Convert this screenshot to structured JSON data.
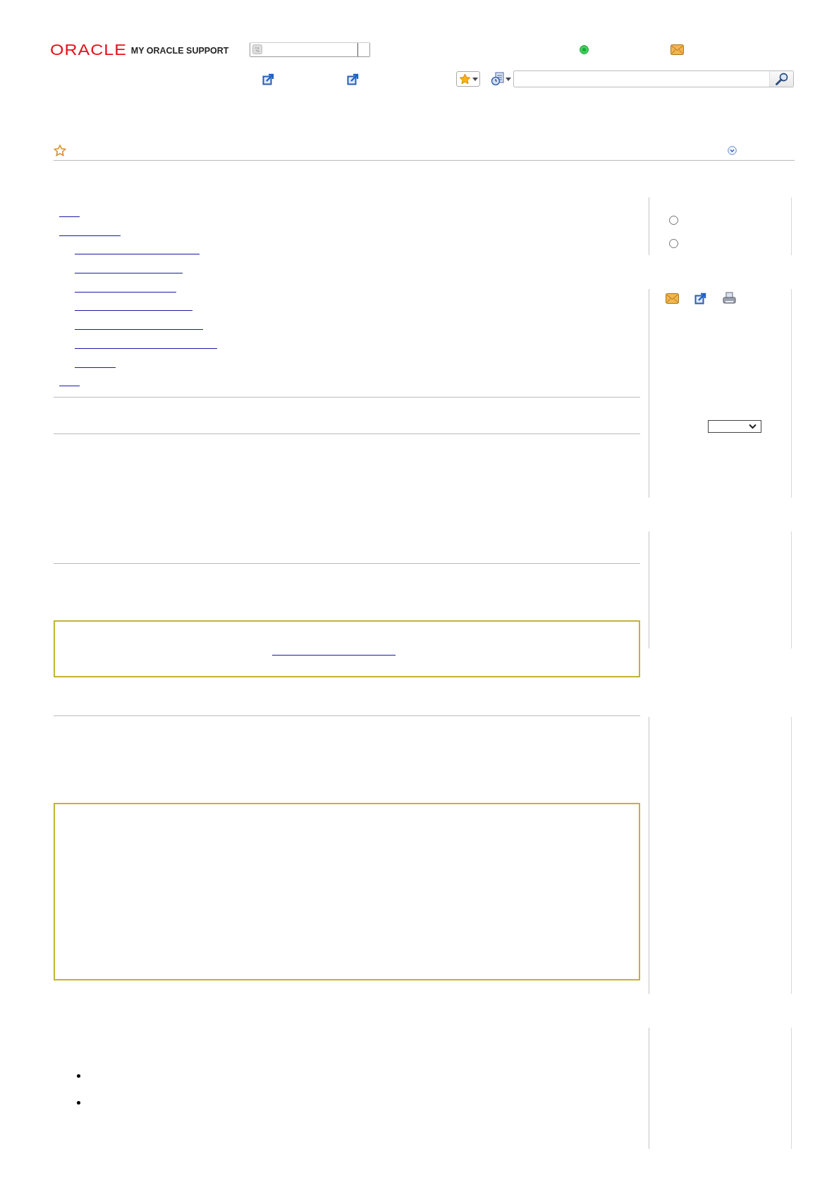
{
  "header": {
    "logo": "ORACLE",
    "product": "MY ORACLE SUPPORT"
  },
  "options": [
    {
      "selected": false
    },
    {
      "selected": false
    }
  ]
}
